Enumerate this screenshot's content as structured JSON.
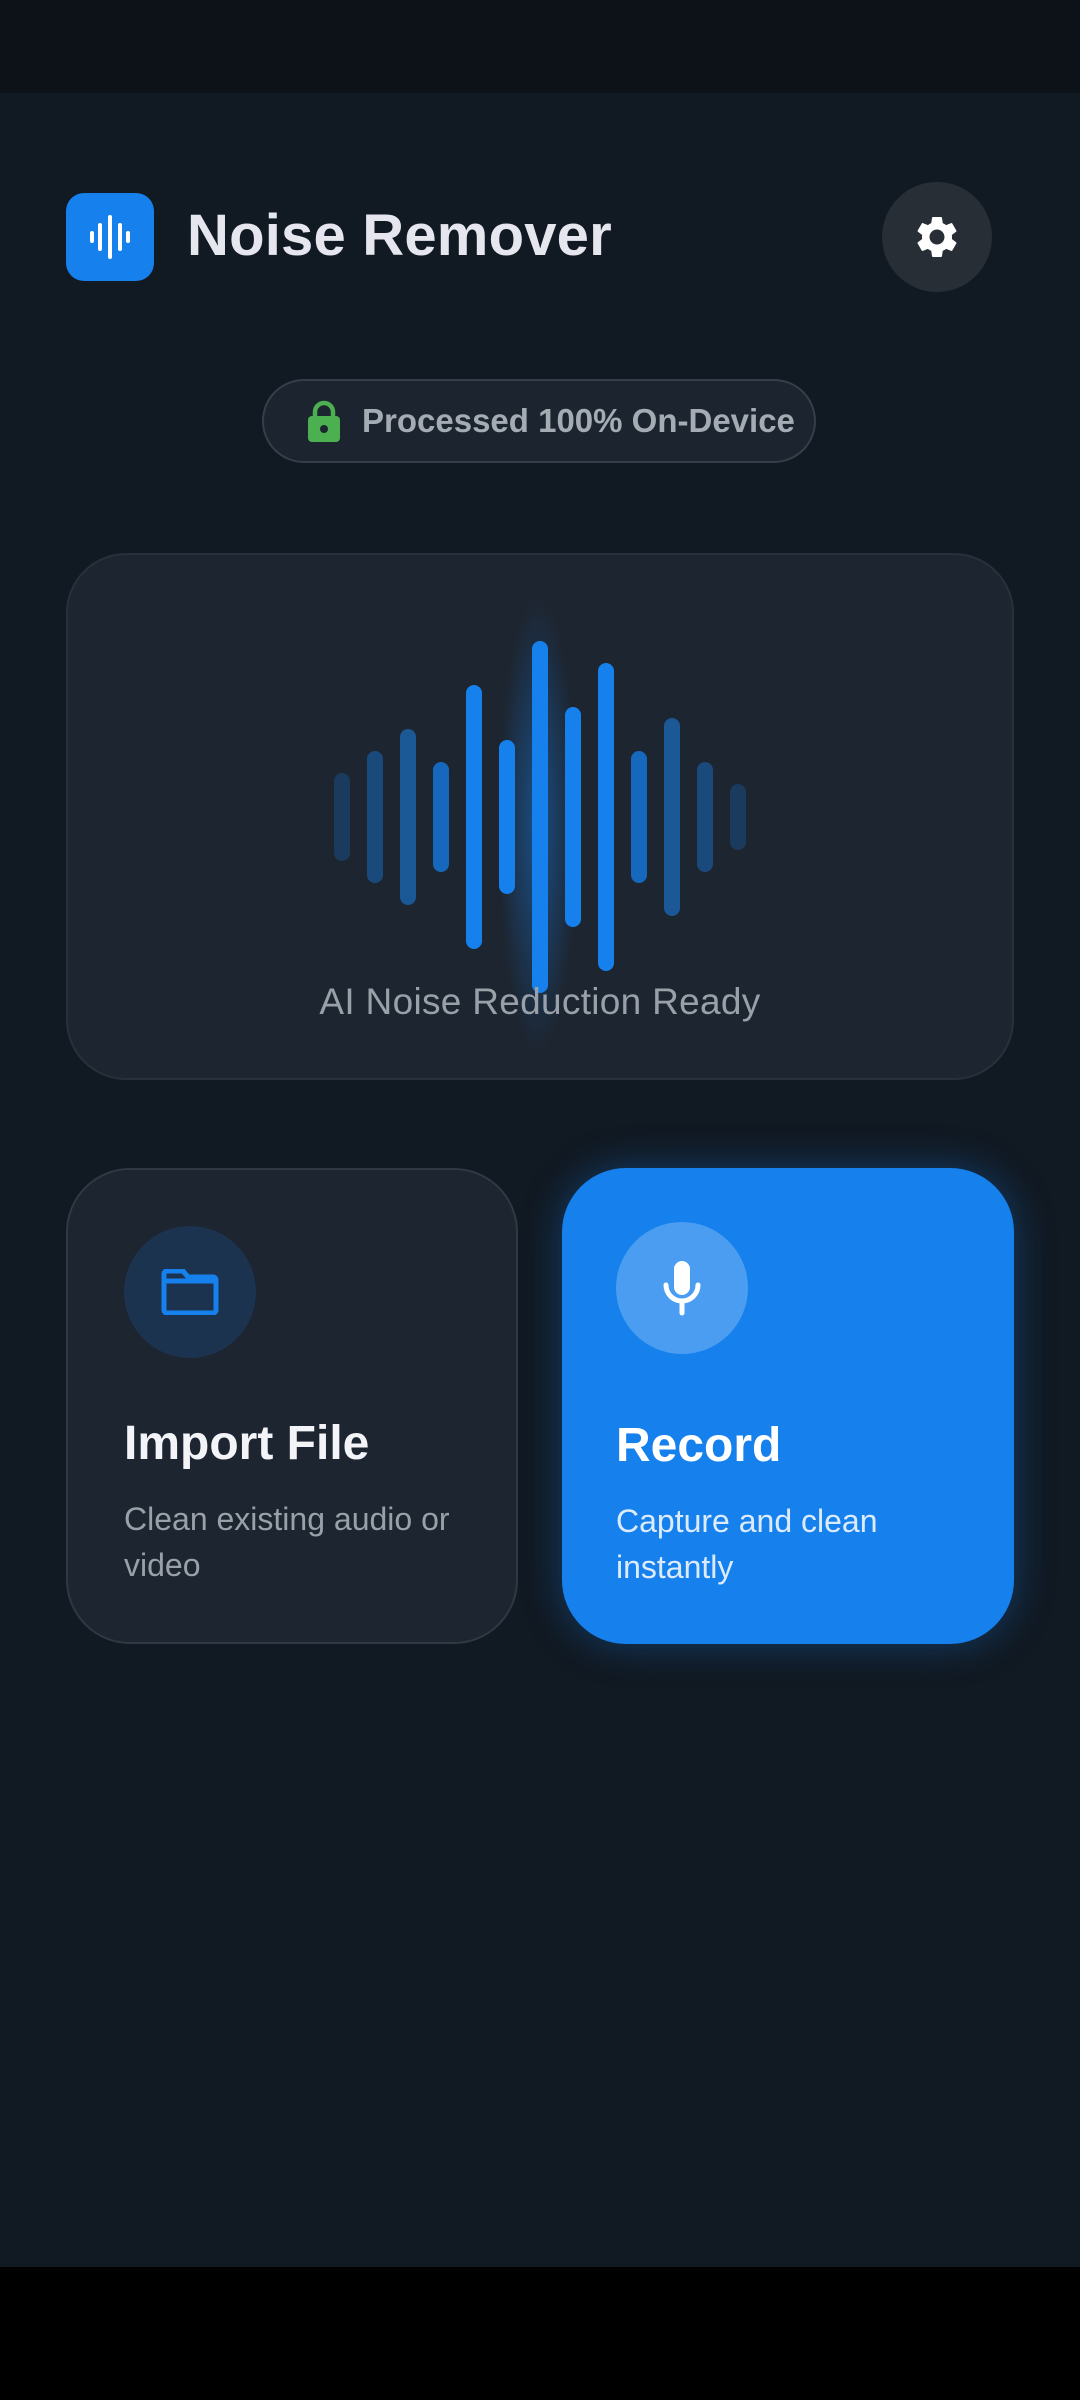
{
  "app": {
    "title": "Noise Remover",
    "logo_icon": "waveform-icon",
    "settings_icon": "gear-icon",
    "accent": "#1681ed",
    "background": "#111922"
  },
  "privacy_badge": {
    "text": "Processed 100% On-Device",
    "icon": "lock-icon",
    "icon_color": "#4caf50"
  },
  "hero": {
    "caption": "AI Noise Reduction Ready",
    "visual": "audio-waveform"
  },
  "actions": [
    {
      "title": "Import File",
      "subtitle": "Clean existing audio or video",
      "icon": "folder-icon"
    },
    {
      "title": "Record",
      "subtitle": "Capture and clean instantly",
      "icon": "microphone-icon"
    }
  ]
}
